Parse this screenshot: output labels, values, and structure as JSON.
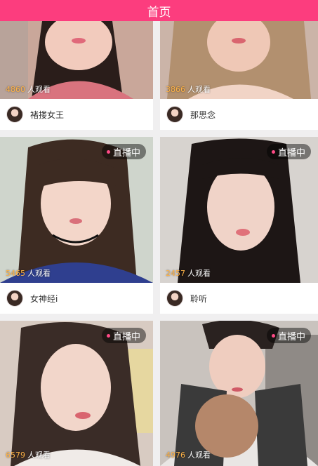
{
  "header": {
    "title": "首页"
  },
  "live_label": "直播中",
  "viewers_suffix": "人观看",
  "rooms": [
    {
      "viewers": "4860",
      "name": "褚搂女王",
      "live": false
    },
    {
      "viewers": "3866",
      "name": "那思念",
      "live": false
    },
    {
      "viewers": "5465",
      "name": "女神经i",
      "live": true
    },
    {
      "viewers": "2457",
      "name": "聆听",
      "live": true
    },
    {
      "viewers": "6579",
      "name": "",
      "live": true
    },
    {
      "viewers": "4976",
      "name": "",
      "live": true
    }
  ],
  "colors": {
    "header": "#fc3d7e",
    "viewer_count": "#ffb347",
    "live_dot": "#ff4a86"
  }
}
